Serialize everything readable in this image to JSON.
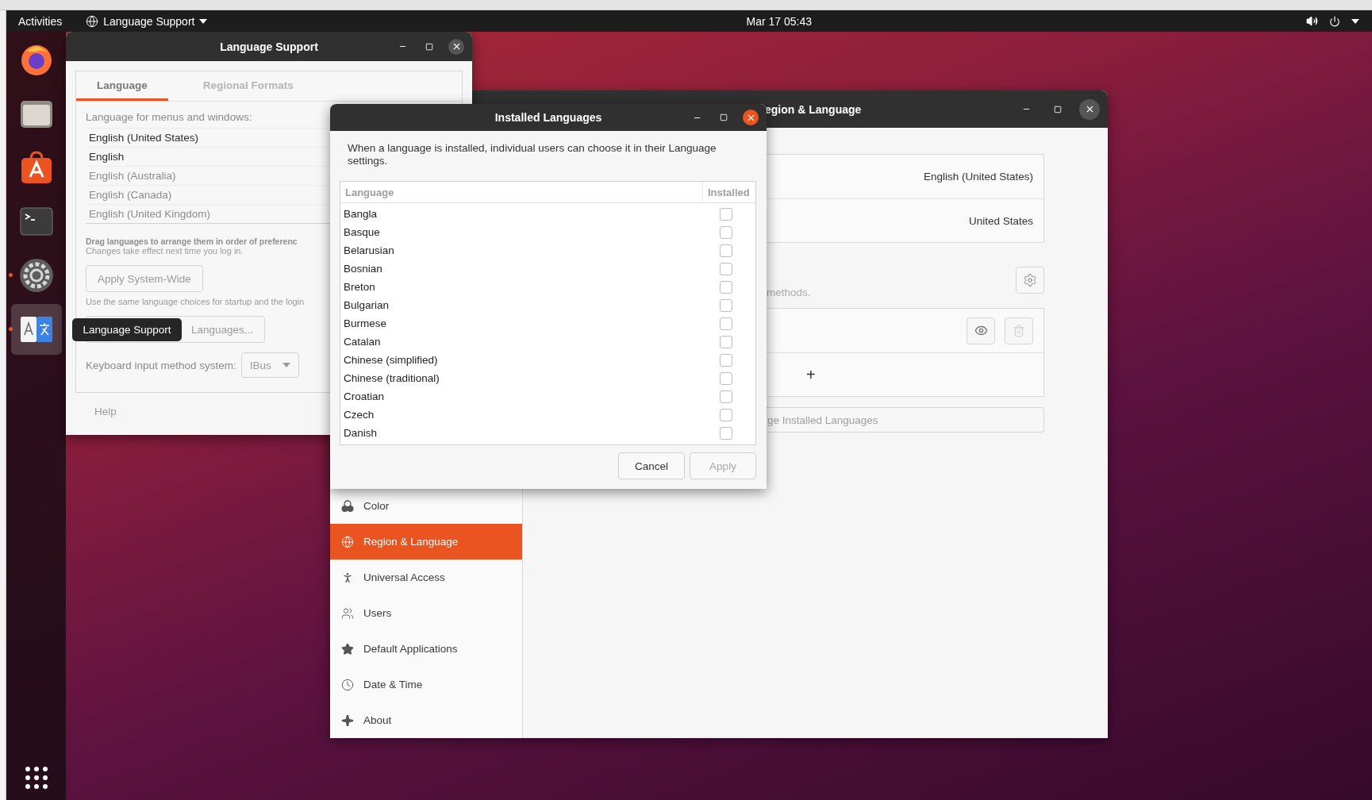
{
  "top_bar": {
    "activities": "Activities",
    "app_menu": "Language Support",
    "clock": "Mar 17 05:43"
  },
  "dock": {
    "items": [
      {
        "kind": "browser",
        "running": false,
        "selected": false
      },
      {
        "kind": "files",
        "running": false,
        "selected": false
      },
      {
        "kind": "software",
        "running": false,
        "selected": false
      },
      {
        "kind": "terminal",
        "running": false,
        "selected": false
      },
      {
        "kind": "settings",
        "running": true,
        "selected": false
      },
      {
        "kind": "language",
        "running": true,
        "selected": true
      }
    ]
  },
  "tooltip": "Language Support",
  "language_support_window": {
    "title": "Language Support",
    "tabs": [
      {
        "label": "Language",
        "selected": true
      },
      {
        "label": "Regional Formats",
        "selected": false
      }
    ],
    "list_label": "Language for menus and windows:",
    "languages": [
      {
        "name": "English (United States)",
        "installed": true
      },
      {
        "name": "English",
        "installed": true
      },
      {
        "name": "English (Australia)",
        "installed": false
      },
      {
        "name": "English (Canada)",
        "installed": false
      },
      {
        "name": "English (United Kingdom)",
        "installed": false
      }
    ],
    "drag_hint": "Drag languages to arrange them in order of preferenc",
    "changes_hint": "Changes take effect next time you log in.",
    "apply_button": "Apply System-Wide",
    "apply_note": "Use the same language choices for startup and the login",
    "install_button": "Languages...",
    "input_label": "Keyboard input method system:",
    "input_value": "IBus",
    "help_button": "Help"
  },
  "region_window": {
    "title": "egion & Language",
    "language_value": "English (United States)",
    "formats_value": "United States",
    "methods_note": "methods.",
    "add_button": "+",
    "manage_button": "ge Installed Languages",
    "sidebar": [
      {
        "kind": "color",
        "label": "Color",
        "selected": false
      },
      {
        "kind": "region",
        "label": "Region & Language",
        "selected": true
      },
      {
        "kind": "access",
        "label": "Universal Access",
        "selected": false
      },
      {
        "kind": "users",
        "label": "Users",
        "selected": false
      },
      {
        "kind": "apps",
        "label": "Default Applications",
        "selected": false
      },
      {
        "kind": "time",
        "label": "Date & Time",
        "selected": false
      },
      {
        "kind": "about",
        "label": "About",
        "selected": false
      }
    ]
  },
  "installed_languages_dialog": {
    "title": "Installed Languages",
    "intro": "When a language is installed, individual users can choose it in their Language settings.",
    "columns": [
      "Language",
      "Installed"
    ],
    "rows": [
      {
        "name": "Bangla",
        "installed": false
      },
      {
        "name": "Basque",
        "installed": false
      },
      {
        "name": "Belarusian",
        "installed": false
      },
      {
        "name": "Bosnian",
        "installed": false
      },
      {
        "name": "Breton",
        "installed": false
      },
      {
        "name": "Bulgarian",
        "installed": false
      },
      {
        "name": "Burmese",
        "installed": false
      },
      {
        "name": "Catalan",
        "installed": false
      },
      {
        "name": "Chinese (simplified)",
        "installed": false
      },
      {
        "name": "Chinese (traditional)",
        "installed": false
      },
      {
        "name": "Croatian",
        "installed": false
      },
      {
        "name": "Czech",
        "installed": false
      },
      {
        "name": "Danish",
        "installed": false
      }
    ],
    "buttons": [
      {
        "label": "Cancel",
        "disabled": false
      },
      {
        "label": "Apply",
        "disabled": true
      }
    ]
  }
}
